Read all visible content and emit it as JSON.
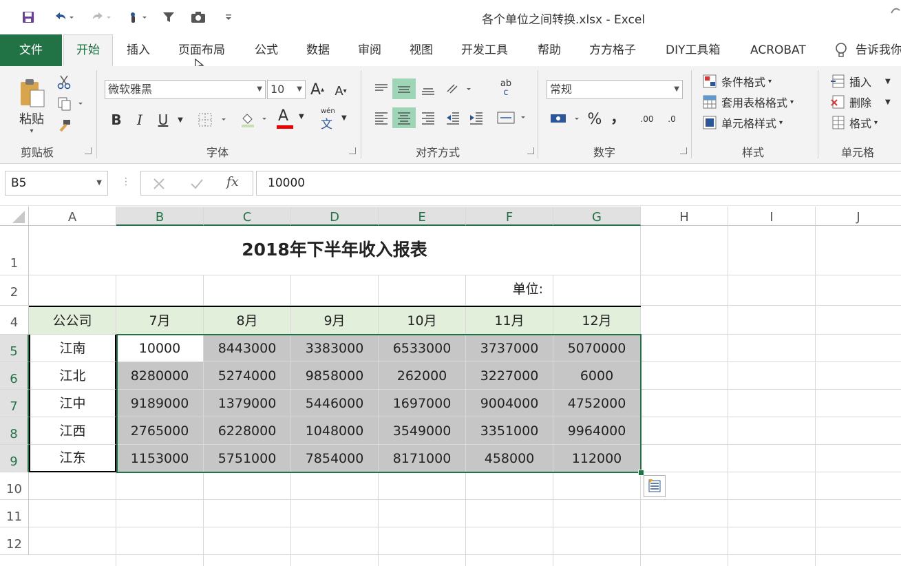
{
  "window": {
    "title": "各个单位之间转换.xlsx  -  Excel"
  },
  "tabs": [
    "文件",
    "开始",
    "插入",
    "页面布局",
    "公式",
    "数据",
    "审阅",
    "视图",
    "开发工具",
    "帮助",
    "方方格子",
    "DIY工具箱",
    "ACROBAT",
    "告诉我你"
  ],
  "ribbon": {
    "clipboard": {
      "paste": "粘贴",
      "label": "剪贴板"
    },
    "font": {
      "name": "微软雅黑",
      "size": "10",
      "bold": "B",
      "italic": "I",
      "underline": "U",
      "label": "字体",
      "phonetic_top": "wén",
      "phonetic_bottom": "文",
      "grow": "A",
      "shrink": "A",
      "color_a": "A"
    },
    "align": {
      "label": "对齐方式",
      "wrap_top": "ab",
      "wrap_bottom": "c"
    },
    "number": {
      "format": "常规",
      "percent": "%",
      "comma": "，",
      "inc": ".00",
      "dec": ".0",
      "label": "数字"
    },
    "styles": {
      "cond": "条件格式",
      "table": "套用表格格式",
      "cell": "单元格样式",
      "label": "样式"
    },
    "cells": {
      "insert": "插入",
      "delete": "删除",
      "format": "格式",
      "label": "单元格"
    }
  },
  "formula_bar": {
    "name_box": "B5",
    "fx": "fx",
    "value": "10000"
  },
  "sheet": {
    "columns": [
      "A",
      "B",
      "C",
      "D",
      "E",
      "F",
      "G",
      "H",
      "I",
      "J"
    ],
    "rows": [
      "1",
      "2",
      "4",
      "5",
      "6",
      "7",
      "8",
      "9",
      "10",
      "11",
      "12"
    ],
    "title": "2018年下半年收入报表",
    "unit_label": "单位:",
    "header_corner": "公公司",
    "months": [
      "7月",
      "8月",
      "9月",
      "10月",
      "11月",
      "12月"
    ],
    "companies": [
      "江南",
      "江北",
      "江中",
      "江西",
      "江东"
    ],
    "values": [
      [
        "10000",
        "8443000",
        "3383000",
        "6533000",
        "3737000",
        "5070000"
      ],
      [
        "8280000",
        "5274000",
        "9858000",
        "262000",
        "3227000",
        "6000"
      ],
      [
        "9189000",
        "1379000",
        "5446000",
        "1697000",
        "9004000",
        "4752000"
      ],
      [
        "2765000",
        "6228000",
        "1048000",
        "3549000",
        "3351000",
        "9964000"
      ],
      [
        "1153000",
        "5751000",
        "7854000",
        "8171000",
        "458000",
        "112000"
      ]
    ]
  },
  "colors": {
    "accent": "#217346",
    "header_fill": "#e2efda",
    "selection_fill": "#c6c6c6"
  }
}
